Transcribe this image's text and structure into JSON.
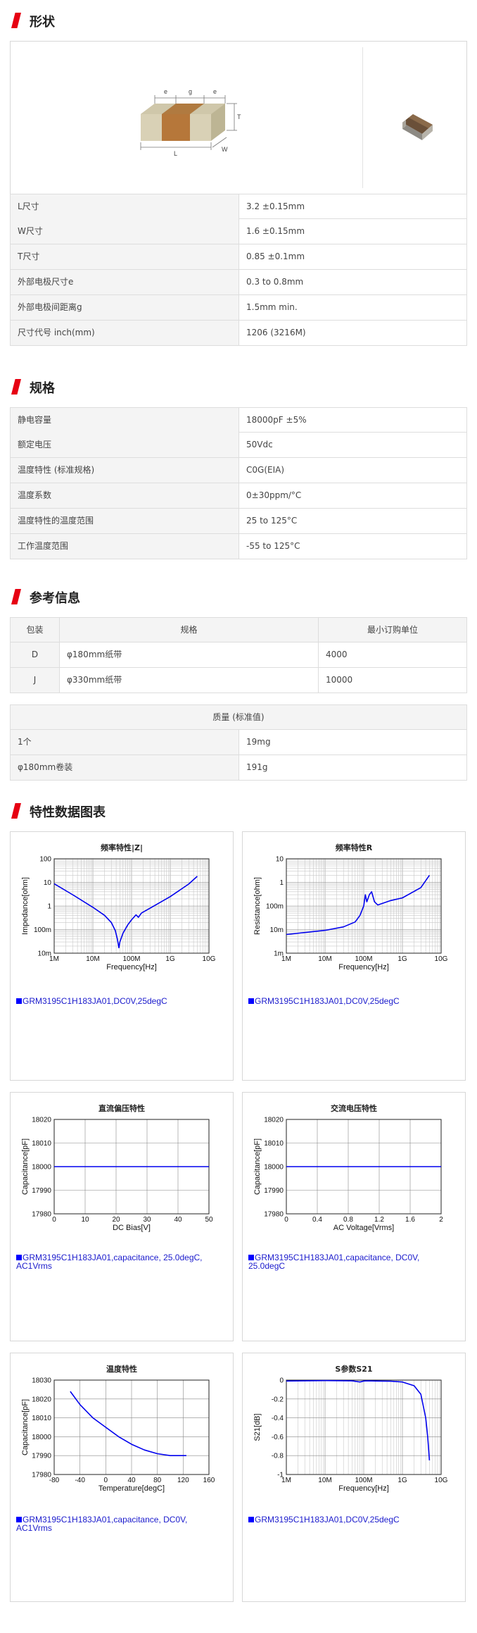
{
  "sections": {
    "shape": "形状",
    "spec": "规格",
    "ref": "参考信息",
    "charts": "特性数据图表"
  },
  "diagram_labels": {
    "e1": "e",
    "g": "g",
    "e2": "e",
    "T": "T",
    "L": "L",
    "W": "W"
  },
  "dimensions": [
    {
      "label": "L尺寸",
      "value": "3.2 ±0.15mm"
    },
    {
      "label": "W尺寸",
      "value": "1.6 ±0.15mm"
    },
    {
      "label": "T尺寸",
      "value": "0.85 ±0.1mm"
    },
    {
      "label": "外部电极尺寸e",
      "value": "0.3 to 0.8mm"
    },
    {
      "label": "外部电极间距离g",
      "value": "1.5mm min."
    },
    {
      "label": "尺寸代号 inch(mm)",
      "value": "1206 (3216M)"
    }
  ],
  "specs": [
    {
      "label": "静电容量",
      "value": "18000pF ±5%"
    },
    {
      "label": "额定电压",
      "value": "50Vdc"
    },
    {
      "label": "温度特性 (标准规格)",
      "value": "C0G(EIA)"
    },
    {
      "label": "温度系数",
      "value": "0±30ppm/°C"
    },
    {
      "label": "温度特性的温度范围",
      "value": "25 to 125°C"
    },
    {
      "label": "工作温度范围",
      "value": "-55 to 125°C"
    }
  ],
  "packaging": {
    "headers": [
      "包装",
      "规格",
      "最小订购单位"
    ],
    "rows": [
      {
        "code": "D",
        "spec": "φ180mm纸带",
        "min": "4000"
      },
      {
        "code": "J",
        "spec": "φ330mm纸带",
        "min": "10000"
      }
    ]
  },
  "mass": {
    "header": "质量 (标准值)",
    "rows": [
      {
        "label": "1个",
        "value": "19mg"
      },
      {
        "label": "φ180mm卷装",
        "value": "191g"
      }
    ]
  },
  "chart_data": [
    {
      "type": "line",
      "title": "频率特性|Z|",
      "xlabel": "Frequency[Hz]",
      "ylabel": "Impedance[ohm]",
      "x_scale": "log",
      "y_scale": "log",
      "xticks": [
        "1M",
        "10M",
        "100M",
        "1G",
        "10G"
      ],
      "yticks": [
        "100",
        "10",
        "1",
        "100m",
        "10m"
      ],
      "xlim": [
        1000000,
        10000000000
      ],
      "ylim": [
        0.01,
        100
      ],
      "series": [
        {
          "name": "GRM3195C1H183JA01,DC0V,25degC",
          "x": [
            1000000.0,
            3000000.0,
            10000000.0,
            20000000.0,
            30000000.0,
            38000000.0,
            43000000.0,
            47000000.0,
            50000000.0,
            60000000.0,
            80000000.0,
            100000000.0,
            130000000.0,
            150000000.0,
            180000000.0,
            300000000.0,
            1000000000.0,
            3000000000.0,
            5000000000.0
          ],
          "y": [
            8.8,
            3.0,
            0.88,
            0.4,
            0.2,
            0.09,
            0.04,
            0.017,
            0.03,
            0.07,
            0.16,
            0.26,
            0.42,
            0.33,
            0.5,
            0.8,
            2.5,
            8.5,
            18
          ]
        }
      ],
      "legend": "GRM3195C1H183JA01,DC0V,25degC"
    },
    {
      "type": "line",
      "title": "频率特性R",
      "xlabel": "Frequency[Hz]",
      "ylabel": "Resistance[ohm]",
      "x_scale": "log",
      "y_scale": "log",
      "xticks": [
        "1M",
        "10M",
        "100M",
        "1G",
        "10G"
      ],
      "yticks": [
        "10",
        "1",
        "100m",
        "10m",
        "1m"
      ],
      "xlim": [
        1000000,
        10000000000
      ],
      "ylim": [
        0.001,
        10
      ],
      "series": [
        {
          "name": "GRM3195C1H183JA01,DC0V,25degC",
          "x": [
            1000000.0,
            10000000.0,
            30000000.0,
            60000000.0,
            80000000.0,
            100000000.0,
            110000000.0,
            120000000.0,
            140000000.0,
            160000000.0,
            190000000.0,
            230000000.0,
            500000000.0,
            1000000000.0,
            3000000000.0,
            5000000000.0
          ],
          "y": [
            0.0062,
            0.0093,
            0.013,
            0.021,
            0.04,
            0.1,
            0.3,
            0.15,
            0.3,
            0.4,
            0.15,
            0.11,
            0.17,
            0.22,
            0.6,
            2.0
          ]
        }
      ],
      "legend": "GRM3195C1H183JA01,DC0V,25degC"
    },
    {
      "type": "line",
      "title": "直流偏压特性",
      "xlabel": "DC Bias[V]",
      "ylabel": "Capacitance[pF]",
      "xticks": [
        "0",
        "10",
        "20",
        "30",
        "40",
        "50"
      ],
      "yticks": [
        "18020",
        "18010",
        "18000",
        "17990",
        "17980"
      ],
      "xlim": [
        0,
        50
      ],
      "ylim": [
        17980,
        18020
      ],
      "series": [
        {
          "name": "GRM3195C1H183JA01,capacitance, 25.0degC, AC1Vrms",
          "x": [
            0,
            50
          ],
          "y": [
            18000,
            18000
          ]
        }
      ],
      "legend": "GRM3195C1H183JA01,capacitance, 25.0degC, AC1Vrms"
    },
    {
      "type": "line",
      "title": "交流电压特性",
      "xlabel": "AC Voltage[Vrms]",
      "ylabel": "Capacitance[pF]",
      "xticks": [
        "0",
        "0.4",
        "0.8",
        "1.2",
        "1.6",
        "2"
      ],
      "yticks": [
        "18020",
        "18010",
        "18000",
        "17990",
        "17980"
      ],
      "xlim": [
        0,
        2
      ],
      "ylim": [
        17980,
        18020
      ],
      "series": [
        {
          "name": "GRM3195C1H183JA01,capacitance, DC0V, 25.0degC",
          "x": [
            0,
            2
          ],
          "y": [
            18000,
            18000
          ]
        }
      ],
      "legend": "GRM3195C1H183JA01,capacitance, DC0V, 25.0degC"
    },
    {
      "type": "line",
      "title": "温度特性",
      "xlabel": "Temperature[degC]",
      "ylabel": "Capacitance[pF]",
      "xticks": [
        "-80",
        "-40",
        "0",
        "40",
        "80",
        "120",
        "160"
      ],
      "yticks": [
        "18030",
        "18020",
        "18010",
        "18000",
        "17990",
        "17980"
      ],
      "xlim": [
        -80,
        160
      ],
      "ylim": [
        17980,
        18030
      ],
      "series": [
        {
          "name": "GRM3195C1H183JA01,capacitance, DC0V, AC1Vrms",
          "x": [
            -55,
            -40,
            -20,
            0,
            20,
            40,
            60,
            80,
            100,
            125
          ],
          "y": [
            18024,
            18017,
            18010,
            18005,
            18000,
            17996,
            17993,
            17991,
            17990,
            17990
          ]
        }
      ],
      "legend": "GRM3195C1H183JA01,capacitance, DC0V, AC1Vrms"
    },
    {
      "type": "line",
      "title": "S参数S21",
      "xlabel": "Frequency[Hz]",
      "ylabel": "S21[dB]",
      "x_scale": "log",
      "xticks": [
        "1M",
        "10M",
        "100M",
        "1G",
        "10G"
      ],
      "yticks": [
        "0",
        "-0.2",
        "-0.4",
        "-0.6",
        "-0.8",
        "-1"
      ],
      "xlim": [
        1000000,
        10000000000
      ],
      "ylim": [
        -1,
        0
      ],
      "series": [
        {
          "name": "GRM3195C1H183JA01,DC0V,25degC",
          "x": [
            1000000.0,
            10000000.0,
            50000000.0,
            80000000.0,
            100000000.0,
            130000000.0,
            200000000.0,
            500000000.0,
            1000000000.0,
            2000000000.0,
            3000000000.0,
            4000000000.0,
            4500000000.0,
            5000000000.0
          ],
          "y": [
            -0.01,
            -0.005,
            -0.008,
            -0.02,
            -0.01,
            -0.008,
            -0.01,
            -0.012,
            -0.02,
            -0.06,
            -0.15,
            -0.4,
            -0.6,
            -0.85
          ]
        }
      ],
      "legend": "GRM3195C1H183JA01,DC0V,25degC"
    }
  ]
}
